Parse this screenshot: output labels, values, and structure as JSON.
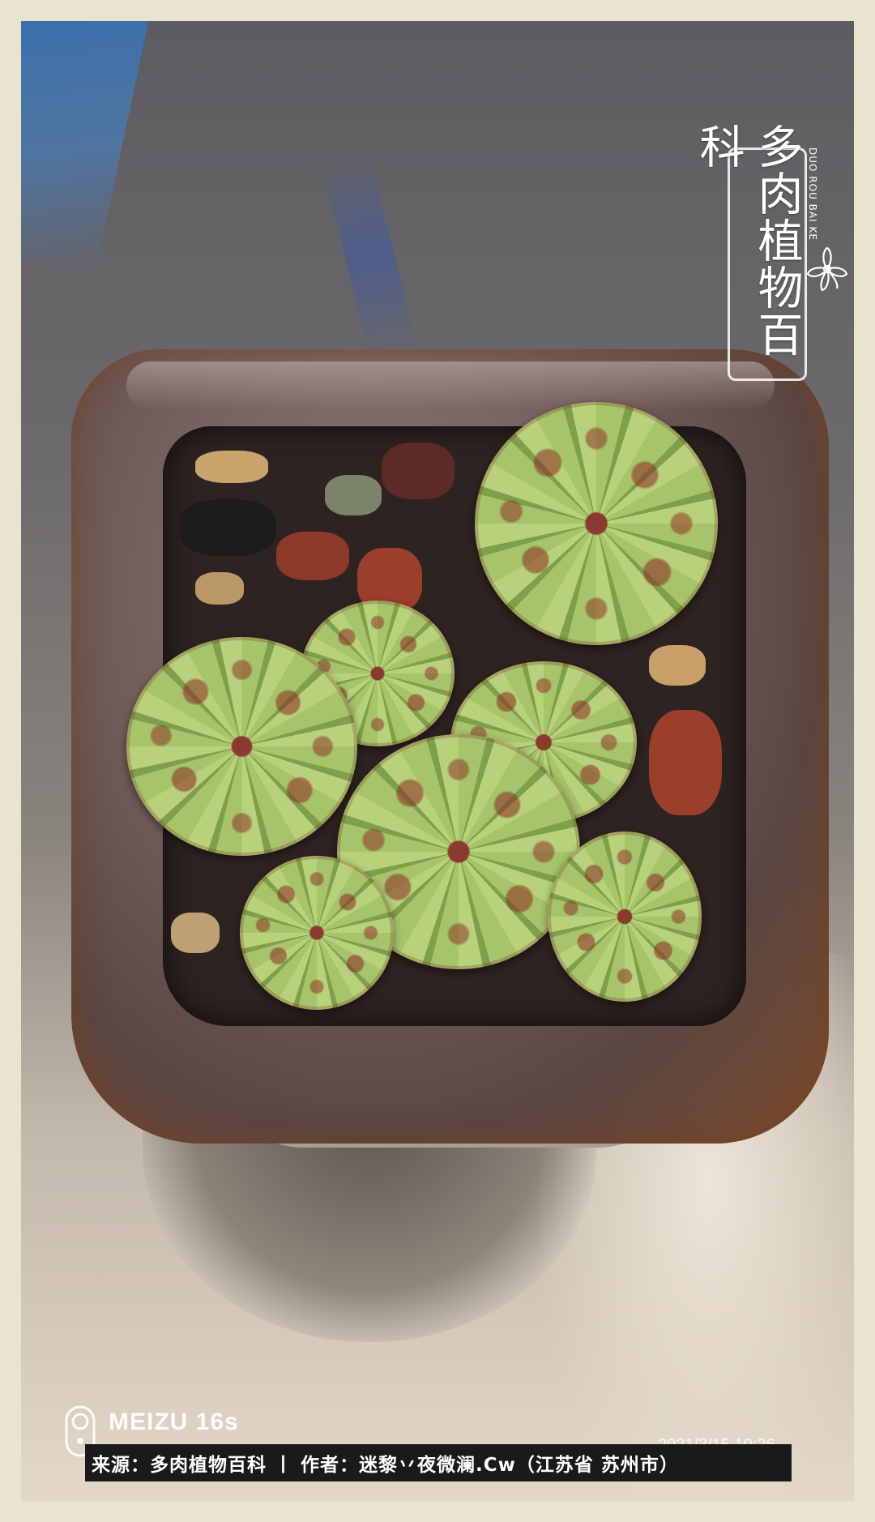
{
  "logo": {
    "text": "多肉植物百科",
    "pinyin": "DUO ROU BAI KE",
    "icon": "flower-icon"
  },
  "camera": {
    "brand": "MEIZU 16s",
    "icon": "camera-lens-icon",
    "timestamp": "2021/3/15  10:26"
  },
  "caption": {
    "text": "来源：多肉植物百科 丨 作者：迷黎丷夜微澜.Cw（江苏省 苏州市）"
  },
  "colors": {
    "frame": "#e8e4cf",
    "caption_bg": "#1a1a1a",
    "caption_text": "#ffffff"
  }
}
